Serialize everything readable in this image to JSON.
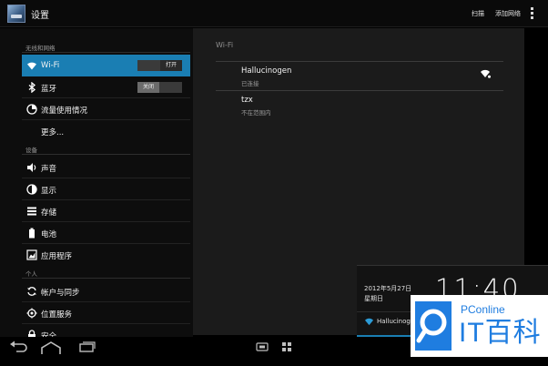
{
  "action_bar": {
    "title": "设置",
    "scan": "扫描",
    "add_network": "添加网络"
  },
  "sidebar": {
    "sections": {
      "wireless": "无线和网络",
      "device": "设备",
      "personal": "个人"
    },
    "items": {
      "wifi": {
        "label": "Wi-Fi",
        "toggle": "打开",
        "icon": "wifi-icon"
      },
      "bluetooth": {
        "label": "蓝牙",
        "toggle": "关闭",
        "icon": "bluetooth-icon"
      },
      "data_usage": {
        "label": "流量使用情况",
        "icon": "pie-chart-icon"
      },
      "more": {
        "label": "更多..."
      },
      "sound": {
        "label": "声音",
        "icon": "speaker-icon"
      },
      "display": {
        "label": "显示",
        "icon": "brightness-icon"
      },
      "storage": {
        "label": "存储",
        "icon": "storage-icon"
      },
      "battery": {
        "label": "电池",
        "icon": "battery-icon"
      },
      "apps": {
        "label": "应用程序",
        "icon": "apps-icon"
      },
      "accounts": {
        "label": "帐户与同步",
        "icon": "sync-icon"
      },
      "location": {
        "label": "位置服务",
        "icon": "location-icon"
      },
      "security": {
        "label": "安全",
        "icon": "lock-icon"
      }
    },
    "selected": "wifi"
  },
  "wifi_panel": {
    "header": "Wi-Fi",
    "networks": [
      {
        "name": "Hallucinogen",
        "status": "已连接"
      },
      {
        "name": "tzx",
        "status": "不在范围内"
      }
    ]
  },
  "notification": {
    "date": "2012年5月27日",
    "weekday": "星期日",
    "time": "11:40",
    "network": "Hallucinogen"
  },
  "watermark": {
    "top_text": "PConline",
    "main_text": "IT百科"
  },
  "colors": {
    "accent": "#1a7eb3",
    "logo_blue": "#1f7de0"
  }
}
